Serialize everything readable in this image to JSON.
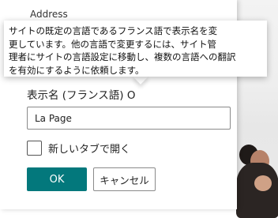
{
  "header": {
    "address_label": "Address"
  },
  "tooltip": {
    "lines": [
      "サイトの既定の言語であるフランス語で表示名を変",
      "更しています。他の言語で変更するには、サイト管",
      "理者にサイトの言語設定に移動し、複数の言語への翻訳",
      "を有効にするように依頼します。"
    ]
  },
  "form": {
    "display_name_label": "表示名 (フランス語) O",
    "display_name_value": "La Page",
    "open_new_tab_label": "新しいタブで開く"
  },
  "buttons": {
    "ok_label": "OK",
    "cancel_label": "キャンセル"
  },
  "colors": {
    "accent": "#03787c"
  }
}
